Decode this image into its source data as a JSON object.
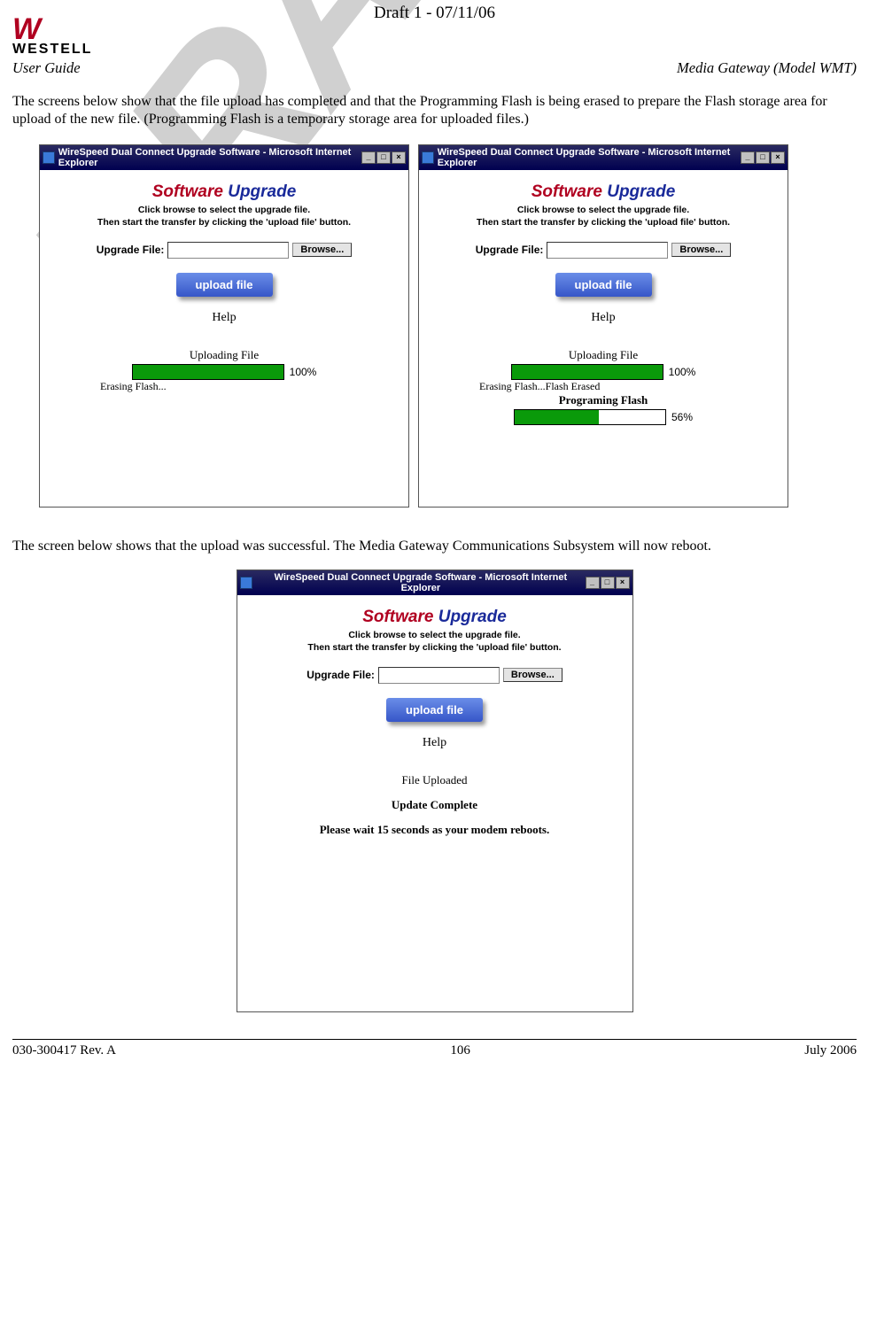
{
  "draft_header": "Draft 1 - 07/11/06",
  "watermark": "DRAFT",
  "logo": {
    "mark": "W",
    "brand": "WESTELL"
  },
  "header": {
    "left": "User Guide",
    "right": "Media Gateway (Model WMT)"
  },
  "para1": "The screens below show that the file upload has completed and that the Programming Flash is being erased to prepare the Flash storage area for upload of the new file. (Programming Flash is a temporary storage area for uploaded files.)",
  "para2": "The screen below shows that the upload was successful. The Media Gateway Communications Subsystem will now reboot.",
  "ie_title": "WireSpeed Dual Connect Upgrade Software - Microsoft Internet Explorer",
  "window_controls": {
    "min": "_",
    "max": "□",
    "close": "×"
  },
  "su": {
    "title1": "Software ",
    "title2": "Upgrade",
    "sub1": "Click browse to select the upgrade file.",
    "sub2": "Then start the transfer by clicking the 'upload file' button.",
    "file_label": "Upgrade File:",
    "browse": "Browse...",
    "upload": "upload file",
    "help": "Help"
  },
  "screen1": {
    "prog_label": "Uploading File",
    "percent": "100%",
    "fill_pct": 100,
    "status": "Erasing Flash..."
  },
  "screen2": {
    "prog1_label": "Uploading File",
    "prog1_percent": "100%",
    "prog1_fill_pct": 100,
    "status1": "Erasing Flash...Flash Erased",
    "prog2_label": "Programing Flash",
    "prog2_percent": "56%",
    "prog2_fill_pct": 56
  },
  "screen3": {
    "line1": "File Uploaded",
    "line2": "Update Complete",
    "line3": "Please wait 15 seconds as your modem reboots."
  },
  "footer": {
    "left": "030-300417 Rev. A",
    "center": "106",
    "right": "July 2006"
  }
}
